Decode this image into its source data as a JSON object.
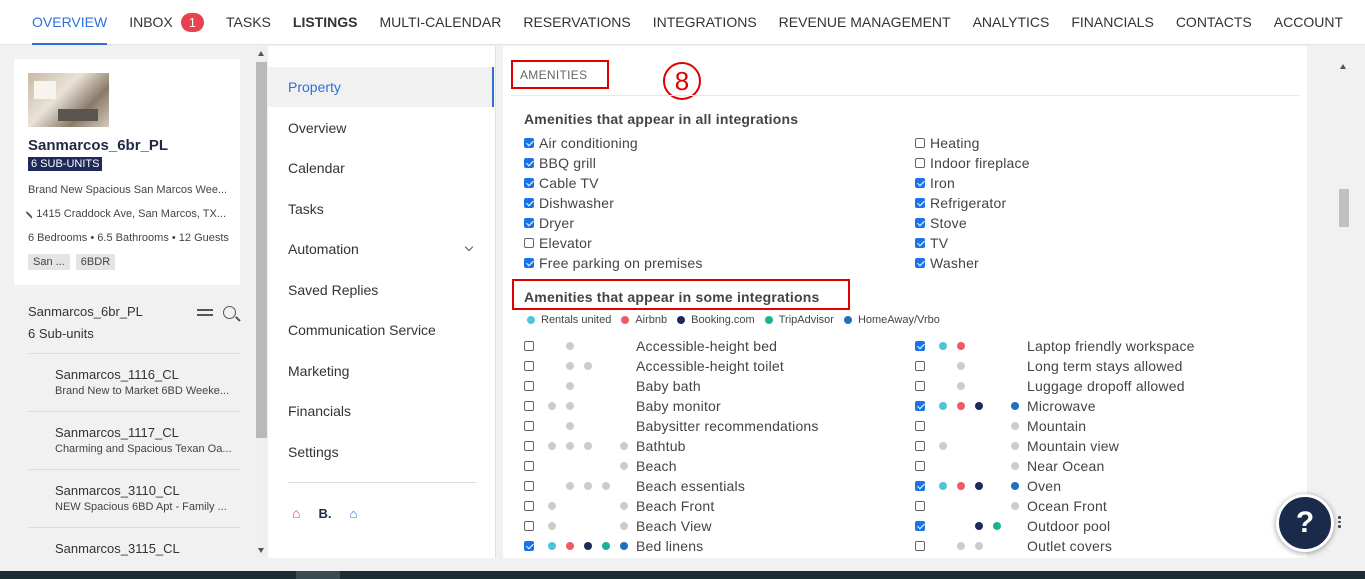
{
  "nav": {
    "items": [
      {
        "label": "OVERVIEW"
      },
      {
        "label": "INBOX",
        "badge": "1"
      },
      {
        "label": "TASKS"
      },
      {
        "label": "LISTINGS"
      },
      {
        "label": "MULTI-CALENDAR"
      },
      {
        "label": "RESERVATIONS"
      },
      {
        "label": "INTEGRATIONS"
      },
      {
        "label": "REVENUE MANAGEMENT"
      },
      {
        "label": "ANALYTICS"
      },
      {
        "label": "FINANCIALS"
      },
      {
        "label": "CONTACTS"
      },
      {
        "label": "ACCOUNT"
      }
    ]
  },
  "property": {
    "name": "Sanmarcos_6br_PL",
    "subunits_badge": "6 SUB-UNITS",
    "description": "Brand New Spacious San Marcos Wee...",
    "address": "1415 Craddock Ave, San Marcos, TX...",
    "bedrooms": "6 Bedrooms",
    "bathrooms": "6.5 Bathrooms",
    "guests": "12 Guests",
    "tags": [
      "San ...",
      "6BDR"
    ]
  },
  "group": {
    "title": "Sanmarcos_6br_PL",
    "subtitle": "6 Sub-units",
    "subunits": [
      {
        "title": "Sanmarcos_1116_CL",
        "desc": "Brand New to Market 6BD Weeke..."
      },
      {
        "title": "Sanmarcos_1117_CL",
        "desc": "Charming and Spacious Texan Oa..."
      },
      {
        "title": "Sanmarcos_3110_CL",
        "desc": "NEW Spacious 6BD Apt - Family ..."
      },
      {
        "title": "Sanmarcos_3115_CL",
        "desc": ""
      }
    ]
  },
  "menu": {
    "items": [
      "Property",
      "Overview",
      "Calendar",
      "Tasks",
      "Automation",
      "Saved Replies",
      "Communication Service",
      "Marketing",
      "Financials",
      "Settings"
    ],
    "channel_icons": {
      "airbnb": "⌂",
      "booking": "B.",
      "vrbo": "⌂"
    }
  },
  "amenities": {
    "label": "AMENITIES",
    "step_marker": "8",
    "all_title": "Amenities that appear in all integrations",
    "all_left": [
      {
        "label": "Air conditioning",
        "checked": true
      },
      {
        "label": "BBQ grill",
        "checked": true
      },
      {
        "label": "Cable TV",
        "checked": true
      },
      {
        "label": "Dishwasher",
        "checked": true
      },
      {
        "label": "Dryer",
        "checked": true
      },
      {
        "label": "Elevator",
        "checked": false
      },
      {
        "label": "Free parking on premises",
        "checked": true
      }
    ],
    "all_right": [
      {
        "label": "Heating",
        "checked": false
      },
      {
        "label": "Indoor fireplace",
        "checked": false
      },
      {
        "label": "Iron",
        "checked": true
      },
      {
        "label": "Refrigerator",
        "checked": true
      },
      {
        "label": "Stove",
        "checked": true
      },
      {
        "label": "TV",
        "checked": true
      },
      {
        "label": "Washer",
        "checked": true
      }
    ],
    "some_title": "Amenities that appear in some integrations",
    "legend": [
      {
        "name": "Rentals united",
        "color": "#4ec4dc"
      },
      {
        "name": "Airbnb",
        "color": "#f05a67"
      },
      {
        "name": "Booking.com",
        "color": "#1e2a5a"
      },
      {
        "name": "TripAdvisor",
        "color": "#1ab394"
      },
      {
        "name": "HomeAway/Vrbo",
        "color": "#1f6fbf"
      }
    ],
    "some_left": [
      {
        "label": "Accessible-height bed",
        "checked": false,
        "dots": [
          0,
          1,
          0,
          0,
          0
        ]
      },
      {
        "label": "Accessible-height toilet",
        "checked": false,
        "dots": [
          0,
          1,
          1,
          0,
          0
        ]
      },
      {
        "label": "Baby bath",
        "checked": false,
        "dots": [
          0,
          1,
          0,
          0,
          0
        ]
      },
      {
        "label": "Baby monitor",
        "checked": false,
        "dots": [
          1,
          1,
          0,
          0,
          0
        ]
      },
      {
        "label": "Babysitter recommendations",
        "checked": false,
        "dots": [
          0,
          1,
          0,
          0,
          0
        ]
      },
      {
        "label": "Bathtub",
        "checked": false,
        "dots": [
          1,
          1,
          1,
          0,
          1
        ]
      },
      {
        "label": "Beach",
        "checked": false,
        "dots": [
          0,
          0,
          0,
          0,
          1
        ]
      },
      {
        "label": "Beach essentials",
        "checked": false,
        "dots": [
          0,
          1,
          1,
          1,
          0
        ]
      },
      {
        "label": "Beach Front",
        "checked": false,
        "dots": [
          1,
          0,
          0,
          0,
          1
        ]
      },
      {
        "label": "Beach View",
        "checked": false,
        "dots": [
          1,
          0,
          0,
          0,
          1
        ]
      },
      {
        "label": "Bed linens",
        "checked": true,
        "dots": [
          2,
          2,
          2,
          2,
          2
        ]
      }
    ],
    "some_right": [
      {
        "label": "Laptop friendly workspace",
        "checked": true,
        "dots": [
          2,
          2,
          0,
          0,
          0
        ]
      },
      {
        "label": "Long term stays allowed",
        "checked": false,
        "dots": [
          0,
          1,
          0,
          0,
          0
        ]
      },
      {
        "label": "Luggage dropoff allowed",
        "checked": false,
        "dots": [
          0,
          1,
          0,
          0,
          0
        ]
      },
      {
        "label": "Microwave",
        "checked": true,
        "dots": [
          2,
          2,
          2,
          0,
          2
        ]
      },
      {
        "label": "Mountain",
        "checked": false,
        "dots": [
          0,
          0,
          0,
          0,
          1
        ]
      },
      {
        "label": "Mountain view",
        "checked": false,
        "dots": [
          1,
          0,
          0,
          0,
          1
        ]
      },
      {
        "label": "Near Ocean",
        "checked": false,
        "dots": [
          0,
          0,
          0,
          0,
          1
        ]
      },
      {
        "label": "Oven",
        "checked": true,
        "dots": [
          2,
          2,
          2,
          0,
          2
        ]
      },
      {
        "label": "Ocean Front",
        "checked": false,
        "dots": [
          0,
          0,
          0,
          0,
          1
        ]
      },
      {
        "label": "Outdoor pool",
        "checked": true,
        "dots": [
          0,
          0,
          2,
          2,
          0
        ]
      },
      {
        "label": "Outlet covers",
        "checked": false,
        "dots": [
          0,
          1,
          1,
          0,
          0
        ]
      }
    ]
  },
  "help": {
    "label": "?"
  },
  "colors": {
    "accent": "#2e6fd8",
    "inactive_dot": "#cccccc",
    "highlight": "#e00000"
  }
}
